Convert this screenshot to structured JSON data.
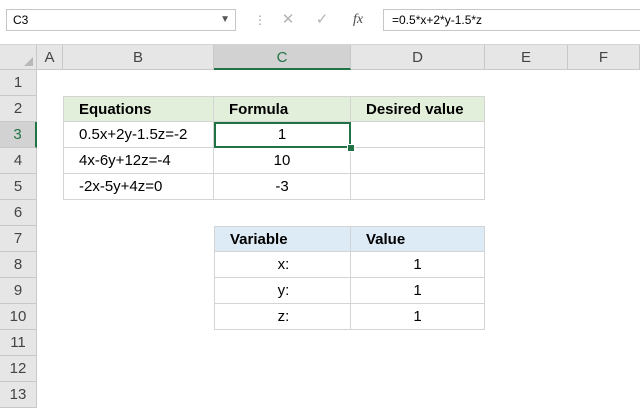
{
  "formula_bar": {
    "name_box": "C3",
    "cancel_icon": "✕",
    "enter_icon": "✓",
    "fx_label": "fx",
    "formula": "=0.5*x+2*y-1.5*z"
  },
  "columns": [
    "A",
    "B",
    "C",
    "D",
    "E",
    "F"
  ],
  "selected_column": "C",
  "rows": [
    "1",
    "2",
    "3",
    "4",
    "5",
    "6",
    "7",
    "8",
    "9",
    "10",
    "11",
    "12",
    "13"
  ],
  "selected_row": "3",
  "table1": {
    "headers": [
      "Equations",
      "Formula",
      "Desired value"
    ],
    "rows": [
      {
        "equation": "0.5x+2y-1.5z=-2",
        "formula": "1",
        "desired": ""
      },
      {
        "equation": "4x-6y+12z=-4",
        "formula": "10",
        "desired": ""
      },
      {
        "equation": "-2x-5y+4z=0",
        "formula": "-3",
        "desired": ""
      }
    ]
  },
  "table2": {
    "headers": [
      "Variable",
      "Value"
    ],
    "rows": [
      {
        "variable": "x:",
        "value": "1"
      },
      {
        "variable": "y:",
        "value": "1"
      },
      {
        "variable": "z:",
        "value": "1"
      }
    ]
  },
  "colors": {
    "accent": "#217346",
    "header_green": "#e2efda",
    "header_blue": "#ddebf7"
  }
}
